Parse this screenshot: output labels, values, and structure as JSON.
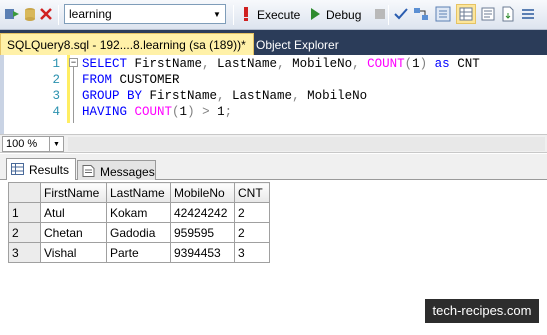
{
  "toolbar": {
    "database": "learning",
    "execute_label": "Execute",
    "debug_label": "Debug"
  },
  "tabs": {
    "active": "SQLQuery8.sql - 192....8.learning (sa (189))*",
    "object_explorer": "Object Explorer"
  },
  "editor": {
    "lines": [
      {
        "num": "1",
        "parts": [
          [
            "kw",
            "SELECT"
          ],
          [
            "",
            "FirstName"
          ],
          [
            "op",
            ","
          ],
          [
            "",
            "LastName"
          ],
          [
            "op",
            ","
          ],
          [
            "",
            "MobileNo"
          ],
          [
            "op",
            ","
          ],
          [
            "fn",
            "COUNT"
          ],
          [
            "op",
            "("
          ],
          [
            "",
            "1"
          ],
          [
            "op",
            ")"
          ],
          [
            "kw",
            "as"
          ],
          [
            "",
            "CNT"
          ]
        ]
      },
      {
        "num": "2",
        "parts": [
          [
            "kw",
            "FROM"
          ],
          [
            "",
            "CUSTOMER"
          ]
        ]
      },
      {
        "num": "3",
        "parts": [
          [
            "kw",
            "GROUP BY"
          ],
          [
            "",
            "FirstName"
          ],
          [
            "op",
            ","
          ],
          [
            "",
            "LastName"
          ],
          [
            "op",
            ","
          ],
          [
            "",
            "MobileNo"
          ]
        ]
      },
      {
        "num": "4",
        "parts": [
          [
            "kw",
            "HAVING"
          ],
          [
            "fn",
            "COUNT"
          ],
          [
            "op",
            "("
          ],
          [
            "",
            "1"
          ],
          [
            "op",
            ")"
          ],
          [
            "op",
            ">"
          ],
          [
            "",
            "1"
          ],
          [
            "op",
            ";"
          ]
        ]
      }
    ]
  },
  "zoom": "100 %",
  "results_tabs": {
    "results": "Results",
    "messages": "Messages"
  },
  "grid": {
    "columns": [
      "FirstName",
      "LastName",
      "MobileNo",
      "CNT"
    ],
    "rows": [
      {
        "num": "1",
        "cells": [
          "Atul",
          "Kokam",
          "42424242",
          "2"
        ]
      },
      {
        "num": "2",
        "cells": [
          "Chetan",
          "Gadodia",
          "959595",
          "2"
        ]
      },
      {
        "num": "3",
        "cells": [
          "Vishal",
          "Parte",
          "9394453",
          "3"
        ]
      }
    ]
  },
  "watermark": "tech-recipes.com"
}
